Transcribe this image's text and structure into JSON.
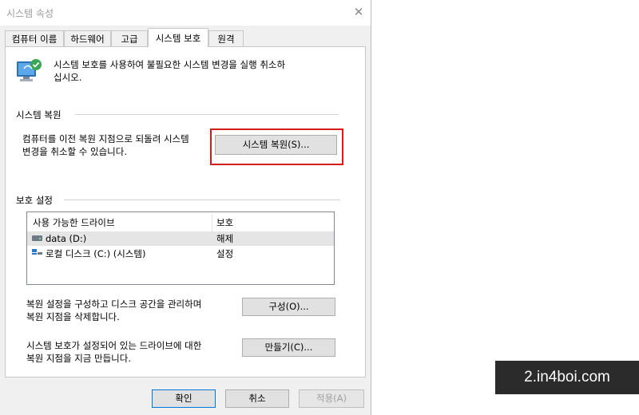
{
  "window": {
    "title": "시스템 속성",
    "close_glyph": "✕"
  },
  "tabs": [
    {
      "label": "컴퓨터 이름",
      "active": false
    },
    {
      "label": "하드웨어",
      "active": false
    },
    {
      "label": "고급",
      "active": false
    },
    {
      "label": "시스템 보호",
      "active": true
    },
    {
      "label": "원격",
      "active": false
    }
  ],
  "intro": {
    "icon": "system-protection-icon",
    "line1": "시스템 보호를 사용하여 불필요한 시스템 변경을 실행 취소하",
    "line2": "십시오."
  },
  "restore_section": {
    "title": "시스템 복원",
    "desc_line1": "컴퓨터를 이전 복원 지점으로 되돌려 시스템",
    "desc_line2": "변경을 취소할 수 있습니다.",
    "button_label": "시스템 복원(S)...",
    "highlight_color": "#d71a1a"
  },
  "protection_section": {
    "title": "보호 설정",
    "columns": {
      "drive": "사용 가능한 드라이브",
      "protection": "보호"
    },
    "drives": [
      {
        "name": "data (D:)",
        "status": "해제",
        "icon": "hard-drive-icon",
        "selected": true
      },
      {
        "name": "로컬 디스크 (C:) (시스템)",
        "status": "설정",
        "icon": "system-drive-icon",
        "selected": false
      }
    ],
    "configure_desc_line1": "복원 설정을 구성하고 디스크 공간을 관리하며",
    "configure_desc_line2": "복원 지점을 삭제합니다.",
    "configure_button": "구성(O)...",
    "create_desc_line1": "시스템 보호가 설정되어 있는 드라이브에 대한",
    "create_desc_line2": "복원 지점을 지금 만듭니다.",
    "create_button": "만들기(C)..."
  },
  "footer": {
    "ok": "확인",
    "cancel": "취소",
    "apply": "적용(A)"
  },
  "watermark": "2.in4boi.com"
}
